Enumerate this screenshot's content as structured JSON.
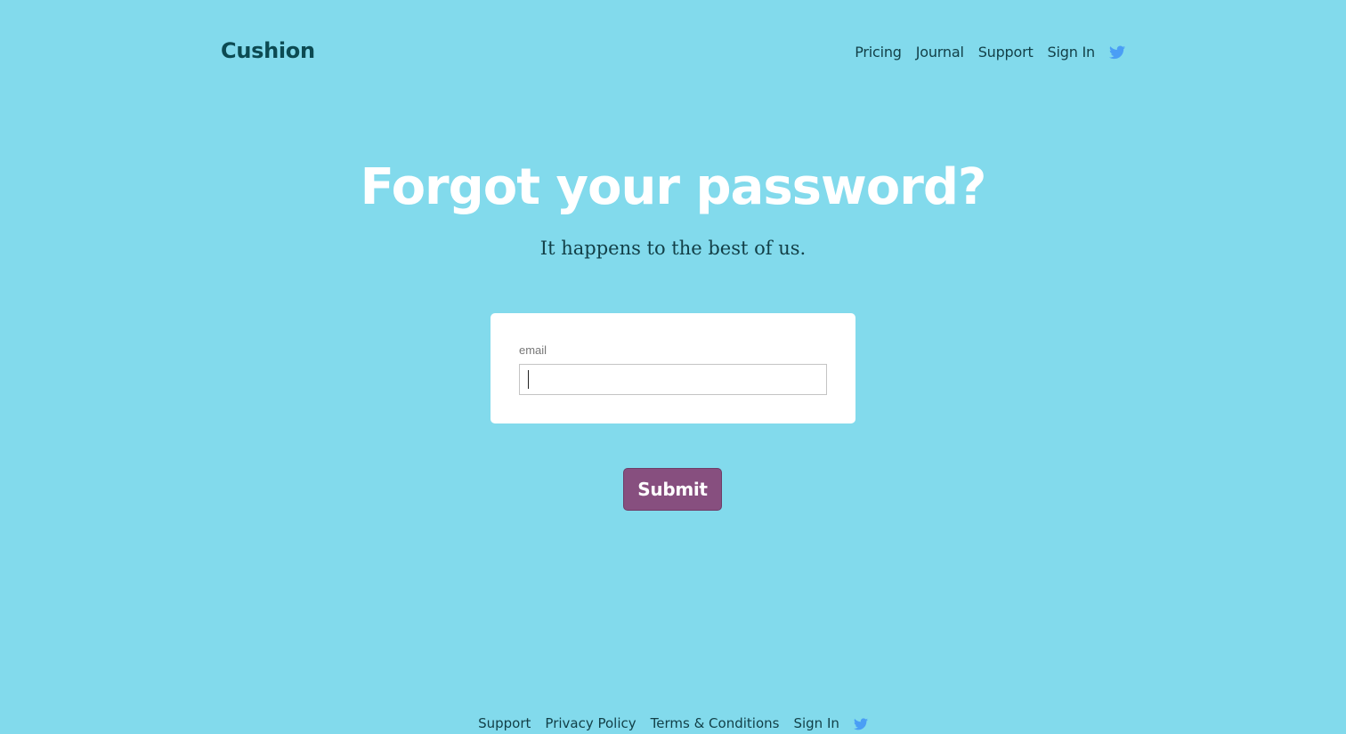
{
  "brand": {
    "name": "Cushion"
  },
  "nav": {
    "items": [
      {
        "label": "Pricing"
      },
      {
        "label": "Journal"
      },
      {
        "label": "Support"
      },
      {
        "label": "Sign In"
      }
    ],
    "twitter_icon": "twitter-bird-icon"
  },
  "hero": {
    "title": "Forgot your password?",
    "subtitle": "It happens to the best of us."
  },
  "form": {
    "email_label": "email",
    "email_value": "",
    "email_placeholder": ""
  },
  "submit": {
    "label": "Submit"
  },
  "footer": {
    "items": [
      {
        "label": "Support"
      },
      {
        "label": "Privacy Policy"
      },
      {
        "label": "Terms & Conditions"
      },
      {
        "label": "Sign In"
      }
    ],
    "twitter_icon": "twitter-bird-icon"
  },
  "colors": {
    "background": "#82daec",
    "brand_text": "#0c4a52",
    "button": "#874f7f",
    "twitter": "#4a9ef5",
    "card": "#ffffff"
  }
}
